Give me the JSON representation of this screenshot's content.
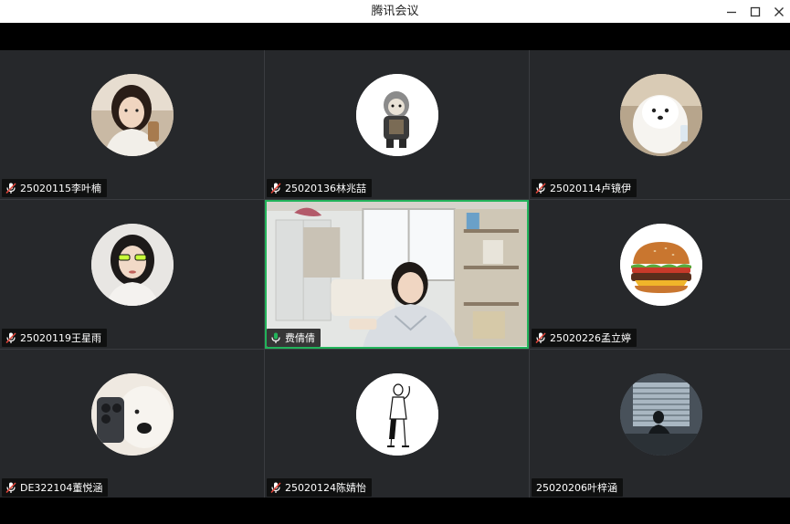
{
  "window": {
    "title": "腾讯会议",
    "icons": [
      "minimize-icon",
      "maximize-icon",
      "close-icon"
    ]
  },
  "participants": [
    {
      "name": "25020115李叶楠",
      "mic": "muted",
      "avatar": "woman-portrait"
    },
    {
      "name": "25020136林兆喆",
      "mic": "muted",
      "avatar": "cartoon-character"
    },
    {
      "name": "25020114卢镜伊",
      "mic": "muted",
      "avatar": "white-dog"
    },
    {
      "name": "25020119王星雨",
      "mic": "muted",
      "avatar": "woman-sunglasses"
    },
    {
      "name": "费倩倩",
      "mic": "active",
      "video": "office-camera-feed"
    },
    {
      "name": "25020226孟立婷",
      "mic": "muted",
      "avatar": "hamburger"
    },
    {
      "name": "DE322104董悦涵",
      "mic": "muted",
      "avatar": "dog-with-phone"
    },
    {
      "name": "25020124陈婧怡",
      "mic": "muted",
      "avatar": "line-drawing-figure"
    },
    {
      "name": "25020206叶梓涵",
      "mic": "none",
      "avatar": "silhouette-window"
    }
  ],
  "colors": {
    "tile_bg": "#26282b",
    "active_border": "#22b35a",
    "muted_mic": "#e0453a",
    "active_mic": "#22b35a"
  }
}
